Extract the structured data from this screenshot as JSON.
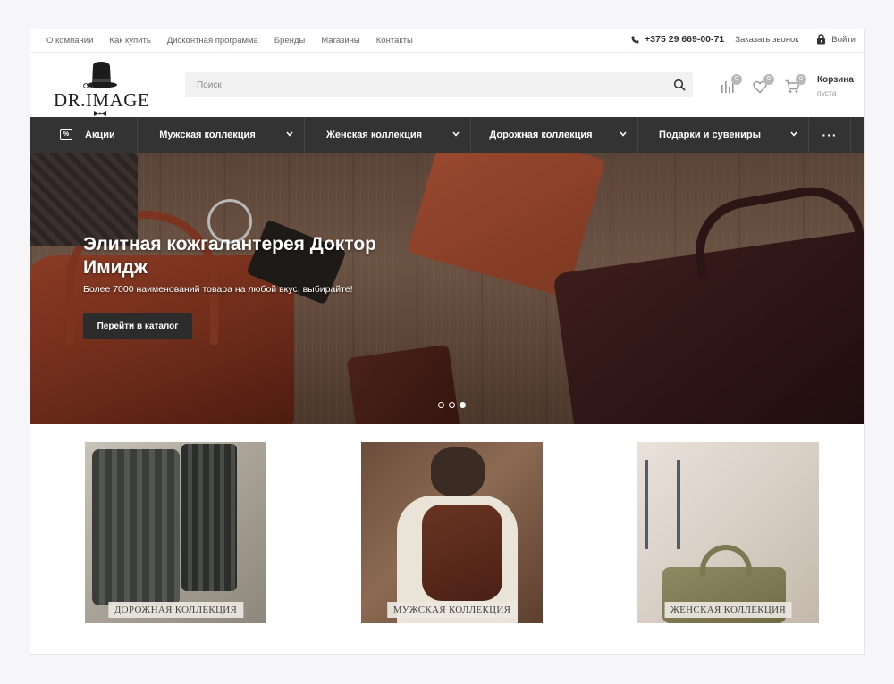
{
  "topbar": {
    "links": [
      "О компании",
      "Как купить",
      "Дисконтная программа",
      "Бренды",
      "Магазины",
      "Контакты"
    ],
    "phone": "+375 29 669-00-71",
    "callback": "Заказать звонок",
    "login": "Войти"
  },
  "header": {
    "logo_text": "DR.IMAGE",
    "search_placeholder": "Поиск",
    "compare_count": "0",
    "wishlist_count": "0",
    "cart_count": "0",
    "cart_title": "Корзина",
    "cart_status": "пуста"
  },
  "nav": {
    "promo": "Акции",
    "men": "Мужская коллекция",
    "women": "Женская коллекция",
    "travel": "Дорожная коллекция",
    "gifts": "Подарки и сувениры",
    "more": "···"
  },
  "hero": {
    "title": "Элитная кожгалантерея Доктор Имидж",
    "subtitle": "Более 7000 наименований товара на любой вкус, выбирайте!",
    "button": "Перейти в каталог",
    "slides": 3,
    "active_slide": 3
  },
  "categories": [
    {
      "label": "ДОРОЖНАЯ КОЛЛЕКЦИЯ"
    },
    {
      "label": "МУЖСКАЯ КОЛЛЕКЦИЯ"
    },
    {
      "label": "ЖЕНСКАЯ КОЛЛЕКЦИЯ"
    }
  ],
  "colors": {
    "nav_bg": "#333333",
    "button_bg": "#2c2c2c",
    "badge": "#b9b9b9"
  },
  "icons": [
    "phone-icon",
    "lock-icon",
    "search-icon",
    "compare-icon",
    "heart-icon",
    "cart-icon",
    "percent-icon",
    "chevron-down-icon",
    "more-icon"
  ]
}
